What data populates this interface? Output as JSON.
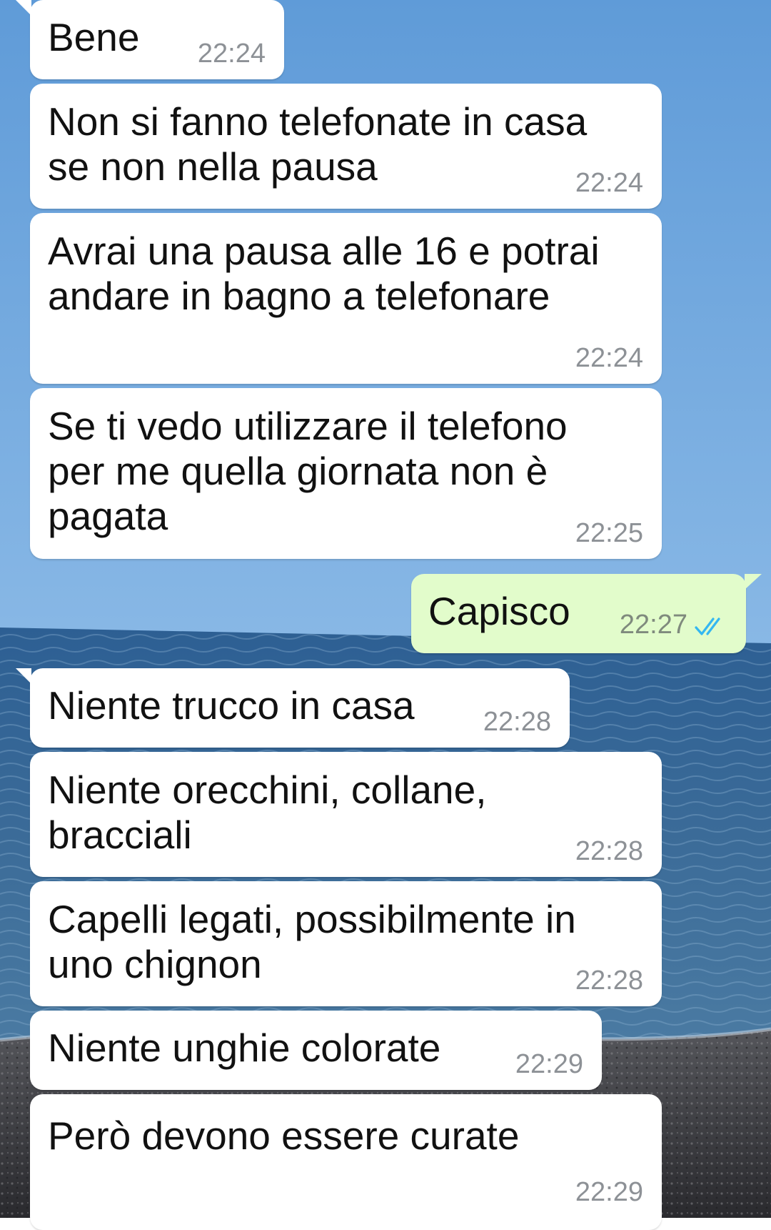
{
  "messages": [
    {
      "direction": "in",
      "text": [
        "Bene"
      ],
      "time": "22:24"
    },
    {
      "direction": "in",
      "text": [
        "Non si fanno telefonate in casa",
        "se non nella pausa"
      ],
      "time": "22:24"
    },
    {
      "direction": "in",
      "text": [
        "Avrai una pausa alle 16 e potrai",
        "andare in bagno a telefonare"
      ],
      "time": "22:24"
    },
    {
      "direction": "in",
      "text": [
        "Se ti vedo utilizzare il telefono",
        "per me quella giornata non è",
        "pagata"
      ],
      "time": "22:25"
    },
    {
      "direction": "out",
      "text": [
        "Capisco"
      ],
      "time": "22:27",
      "status": "read",
      "status_icon": "double-check-icon"
    },
    {
      "direction": "in",
      "text": [
        "Niente trucco in casa"
      ],
      "time": "22:28"
    },
    {
      "direction": "in",
      "text": [
        "Niente orecchini, collane,",
        "bracciali"
      ],
      "time": "22:28"
    },
    {
      "direction": "in",
      "text": [
        "Capelli legati, possibilmente in",
        "uno chignon"
      ],
      "time": "22:28"
    },
    {
      "direction": "in",
      "text": [
        "Niente unghie colorate"
      ],
      "time": "22:29"
    },
    {
      "direction": "in",
      "text": [
        "Però devono essere curate"
      ],
      "time": "22:29"
    }
  ],
  "colors": {
    "incoming_bubble": "#ffffff",
    "outgoing_bubble": "#e2fccb",
    "read_ticks": "#34b7f1",
    "timestamp": "#8d9196",
    "sky": "#7fb2e0",
    "sea": "#3a6690",
    "beach": "#3c3c40"
  }
}
